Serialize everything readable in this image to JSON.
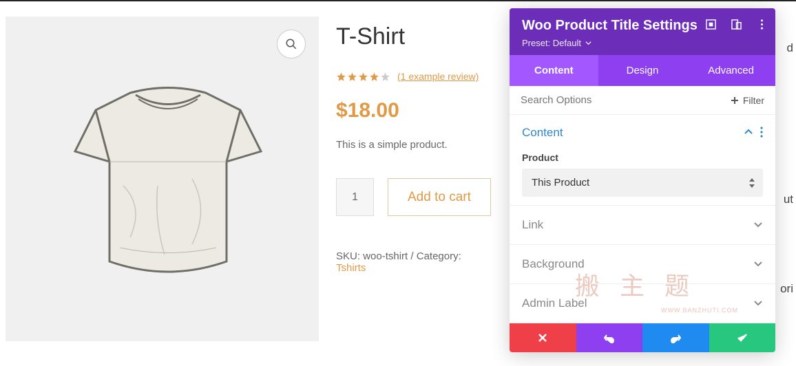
{
  "product": {
    "title": "T-Shirt",
    "rating": 4,
    "review_link": "(1 example review)",
    "price": "$18.00",
    "short_desc": "This is a simple product.",
    "qty": "1",
    "add_to_cart": "Add to cart",
    "sku_label": "SKU:",
    "sku": "woo-tshirt",
    "cat_label": "Category:",
    "cat_link": "Tshirts"
  },
  "panel": {
    "title": "Woo Product Title Settings",
    "preset_label": "Preset: Default",
    "tabs": {
      "content": "Content",
      "design": "Design",
      "advanced": "Advanced"
    },
    "search_placeholder": "Search Options",
    "filter": "Filter",
    "section_content": "Content",
    "product_field_label": "Product",
    "product_select_value": "This Product",
    "section_link": "Link",
    "section_background": "Background",
    "section_admin": "Admin Label"
  },
  "bg": {
    "t1": "d",
    "t2": "ut",
    "t3": "ori"
  },
  "watermark": {
    "main": "搬 主 题",
    "url": "WWW.BANZHUTI.COM"
  }
}
